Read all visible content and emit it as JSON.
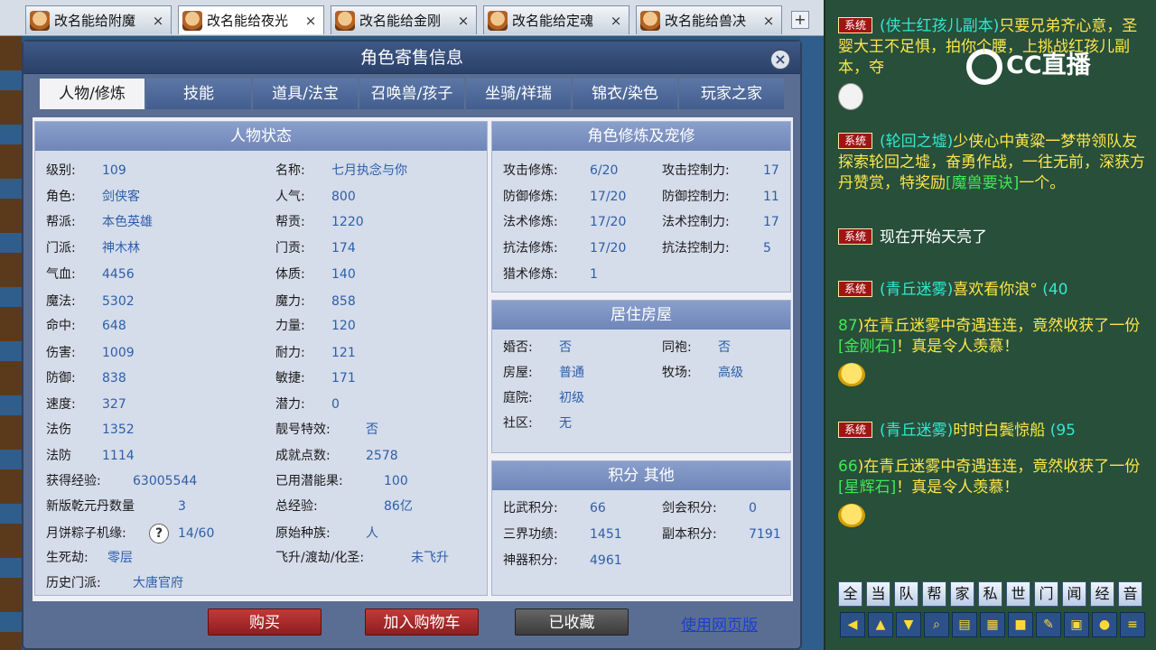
{
  "browser_tabs": [
    {
      "label": "改名能给附魔",
      "active": false
    },
    {
      "label": "改名能给夜光",
      "active": true
    },
    {
      "label": "改名能给金刚",
      "active": false
    },
    {
      "label": "改名能给定魂",
      "active": false
    },
    {
      "label": "改名能给兽决",
      "active": false
    }
  ],
  "tab_close_glyph": "×",
  "new_tab_glyph": "+",
  "dialog": {
    "title": "角色寄售信息",
    "close_glyph": "×",
    "tabs": [
      "人物/修炼",
      "技能",
      "道具/法宝",
      "召唤兽/孩子",
      "坐骑/祥瑞",
      "锦衣/染色",
      "玩家之家"
    ]
  },
  "character_status": {
    "heading": "人物状态",
    "left": [
      {
        "label": "级别:",
        "value": "109"
      },
      {
        "label": "角色:",
        "value": "剑侠客"
      },
      {
        "label": "帮派:",
        "value": "本色英雄"
      },
      {
        "label": "门派:",
        "value": "神木林"
      },
      {
        "label": "气血:",
        "value": "4456"
      },
      {
        "label": "魔法:",
        "value": "5302"
      },
      {
        "label": "命中:",
        "value": "648"
      },
      {
        "label": "伤害:",
        "value": "1009"
      },
      {
        "label": "防御:",
        "value": "838"
      },
      {
        "label": "速度:",
        "value": "327"
      },
      {
        "label": "法伤",
        "value": "1352"
      },
      {
        "label": "法防",
        "value": "1114"
      },
      {
        "label": "获得经验:",
        "value": "63005544"
      },
      {
        "label": "新版乾元丹数量",
        "value": "3"
      },
      {
        "label": "月饼粽子机缘:",
        "value": "14/60",
        "help": "?"
      },
      {
        "label": "生死劫:",
        "value": "零层"
      },
      {
        "label": "历史门派:",
        "value": "大唐官府"
      }
    ],
    "right": [
      {
        "label": "名称:",
        "value": "七月执念与你"
      },
      {
        "label": "人气:",
        "value": "800"
      },
      {
        "label": "帮贡:",
        "value": "1220"
      },
      {
        "label": "门贡:",
        "value": "174"
      },
      {
        "label": "体质:",
        "value": "140"
      },
      {
        "label": "魔力:",
        "value": "858"
      },
      {
        "label": "力量:",
        "value": "120"
      },
      {
        "label": "耐力:",
        "value": "121"
      },
      {
        "label": "敏捷:",
        "value": "171"
      },
      {
        "label": "潜力:",
        "value": "0"
      },
      {
        "label": "靓号特效:",
        "value": "否"
      },
      {
        "label": "成就点数:",
        "value": "2578"
      },
      {
        "label": "已用潜能果:",
        "value": "100"
      },
      {
        "label": "总经验:",
        "value": "86亿"
      },
      {
        "label": "原始种族:",
        "value": "人"
      },
      {
        "label": "飞升/渡劫/化圣:",
        "value": "未飞升"
      }
    ]
  },
  "cultivation": {
    "heading": "角色修炼及宠修",
    "left": [
      {
        "label": "攻击修炼:",
        "value": "6/20"
      },
      {
        "label": "防御修炼:",
        "value": "17/20"
      },
      {
        "label": "法术修炼:",
        "value": "17/20"
      },
      {
        "label": "抗法修炼:",
        "value": "17/20"
      },
      {
        "label": "猎术修炼:",
        "value": "1"
      }
    ],
    "right": [
      {
        "label": "攻击控制力:",
        "value": "17"
      },
      {
        "label": "防御控制力:",
        "value": "11"
      },
      {
        "label": "法术控制力:",
        "value": "17"
      },
      {
        "label": "抗法控制力:",
        "value": "5"
      }
    ]
  },
  "housing": {
    "heading": "居住房屋",
    "left": [
      {
        "label": "婚否:",
        "value": "否"
      },
      {
        "label": "房屋:",
        "value": "普通"
      },
      {
        "label": "庭院:",
        "value": "初级"
      },
      {
        "label": "社区:",
        "value": "无"
      }
    ],
    "right": [
      {
        "label": "同袍:",
        "value": "否"
      },
      {
        "label": "牧场:",
        "value": "高级"
      }
    ]
  },
  "points": {
    "heading": "积分 其他",
    "left": [
      {
        "label": "比武积分:",
        "value": "66"
      },
      {
        "label": "三界功绩:",
        "value": "1451"
      },
      {
        "label": "神器积分:",
        "value": "4961"
      }
    ],
    "right": [
      {
        "label": "剑会积分:",
        "value": "0"
      },
      {
        "label": "副本积分:",
        "value": "7191"
      }
    ]
  },
  "actions": {
    "buy": "购买",
    "add_cart": "加入购物车",
    "favorited": "已收藏",
    "web_page": "使用网页版"
  },
  "stream_logo": "CC直播",
  "chat": {
    "system_tag": "系统",
    "messages": [
      {
        "prefix": "(侠士红孩儿副本)",
        "text": "只要兄弟齐心意，圣婴大王不足惧，拍你个腰，上挑战红孩儿副本，夺"
      },
      {
        "prefix": "(轮回之墟)",
        "text": "少侠心中黄粱一梦带领队友探索轮回之墟，奋勇作战，一往无前，深获方丹赞赏，特奖励",
        "item": "[魔兽要诀]",
        "suffix": "一个。"
      },
      {
        "text": "现在开始天亮了"
      },
      {
        "prefix": "(青丘迷雾)",
        "text": "喜欢看你浪°",
        "num": "(40"
      },
      {
        "num": "87",
        "text": ")在青丘迷雾中奇遇连连，竟然收获了一份",
        "item": "[金刚石]",
        "suffix": "！真是令人羡慕！"
      },
      {
        "prefix": "(青丘迷雾)",
        "text": "时时白鬓惊船",
        "num": "(95"
      },
      {
        "num": "66",
        "text": ")在青丘迷雾中奇遇连连，竟然收获了一份",
        "item": "[星辉石]",
        "suffix": "！真是令人羡慕！"
      }
    ],
    "channels": [
      "全",
      "当",
      "队",
      "帮",
      "家",
      "私",
      "世",
      "门",
      "闻",
      "经",
      "音"
    ],
    "tool_icons": [
      "arrow-left-icon",
      "arrow-up-icon",
      "arrow-down-icon",
      "search-icon",
      "note-icon",
      "grid-icon",
      "lock-icon",
      "brush-icon",
      "window-icon",
      "chat-bubble-icon",
      "list-icon"
    ]
  }
}
